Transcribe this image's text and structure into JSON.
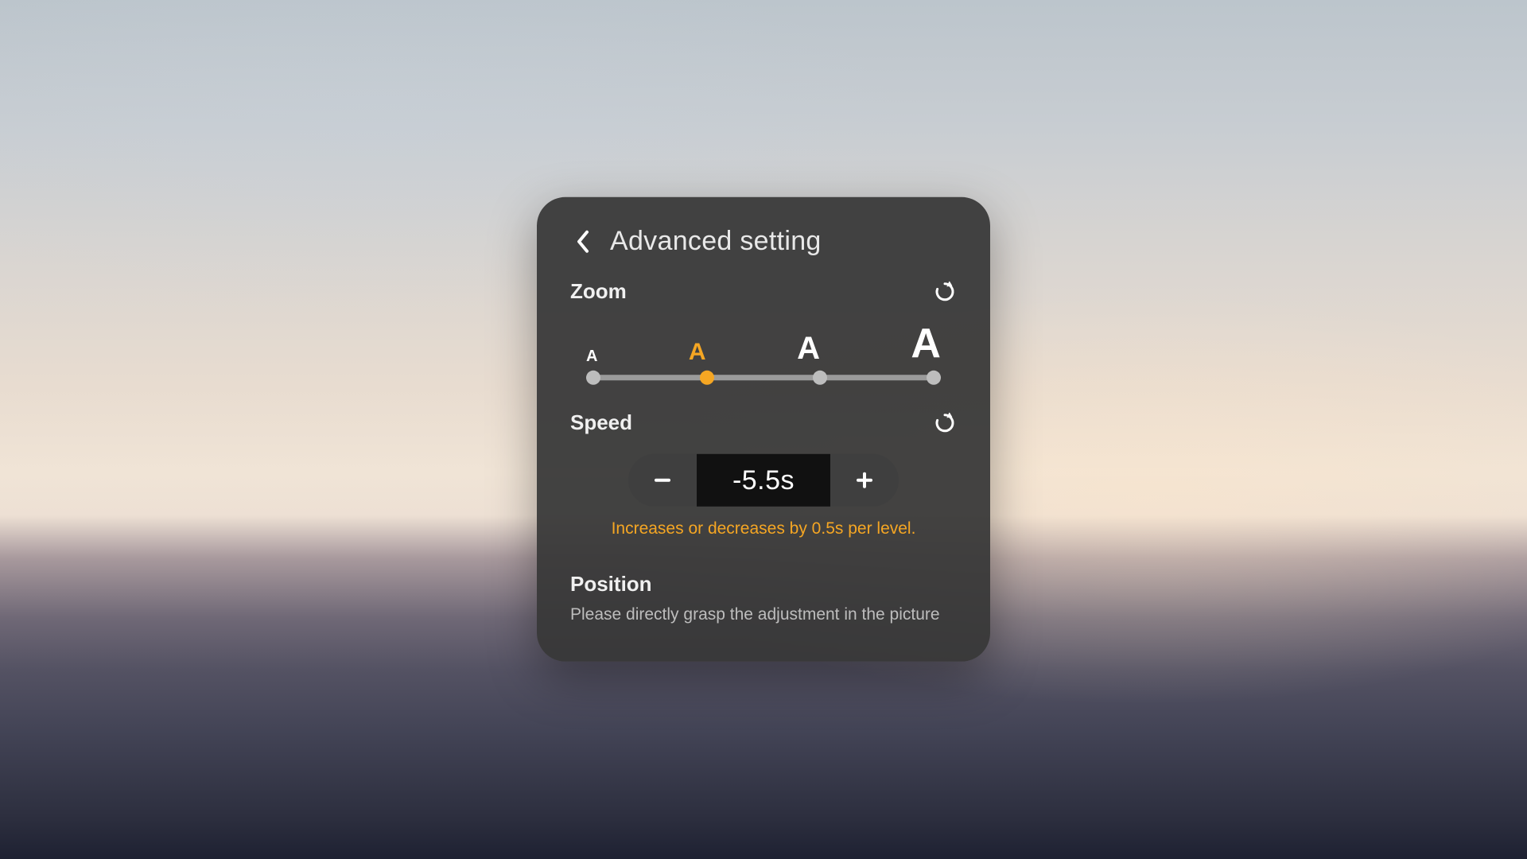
{
  "header": {
    "title": "Advanced setting"
  },
  "zoom": {
    "label": "Zoom",
    "levels": [
      "A",
      "A",
      "A",
      "A"
    ],
    "selected_index": 1
  },
  "speed": {
    "label": "Speed",
    "value": "-5.5s",
    "hint": "Increases or decreases by 0.5s per level."
  },
  "position": {
    "label": "Position",
    "description": "Please directly grasp the adjustment in the picture"
  },
  "colors": {
    "accent": "#f5a623",
    "panel": "rgba(55,55,55,.94)"
  }
}
